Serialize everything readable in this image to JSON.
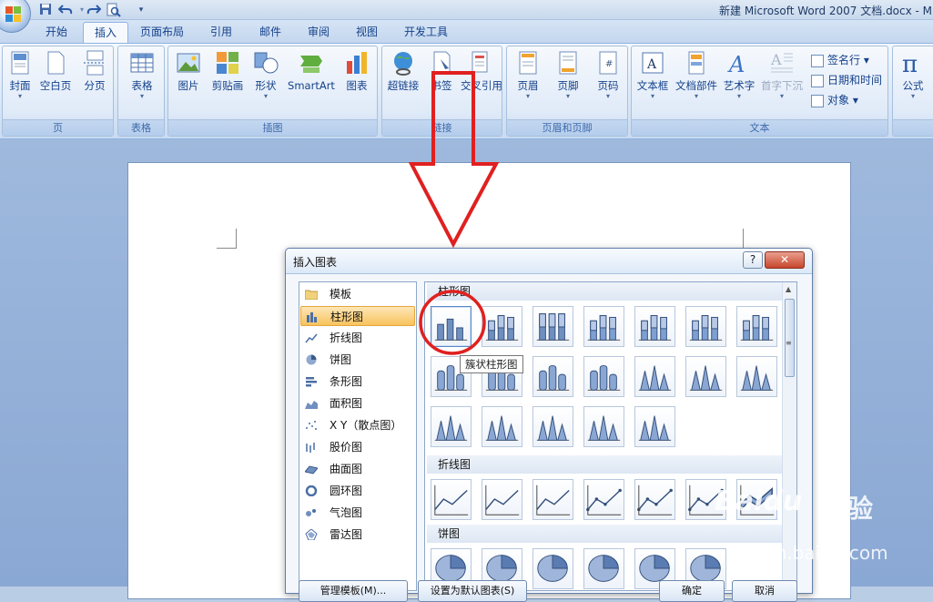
{
  "window": {
    "title": "新建 Microsoft Word 2007 文档.docx - M"
  },
  "quick_access": {
    "icons": [
      "save-icon",
      "undo-icon",
      "redo-icon",
      "print-preview-icon",
      "customize-icon"
    ]
  },
  "tabs": [
    {
      "label": "开始"
    },
    {
      "label": "插入",
      "active": true
    },
    {
      "label": "页面布局"
    },
    {
      "label": "引用"
    },
    {
      "label": "邮件"
    },
    {
      "label": "审阅"
    },
    {
      "label": "视图"
    },
    {
      "label": "开发工具"
    }
  ],
  "ribbon": {
    "groups": [
      {
        "label": "页",
        "buttons": [
          "封面",
          "空白页",
          "分页"
        ]
      },
      {
        "label": "表格",
        "buttons": [
          "表格"
        ]
      },
      {
        "label": "插图",
        "buttons": [
          "图片",
          "剪贴画",
          "形状",
          "SmartArt",
          "图表"
        ]
      },
      {
        "label": "链接",
        "buttons": [
          "超链接",
          "书签",
          "交叉引用"
        ]
      },
      {
        "label": "页眉和页脚",
        "buttons": [
          "页眉",
          "页脚",
          "页码"
        ]
      },
      {
        "label": "文本",
        "buttons": [
          "文本框",
          "文档部件",
          "艺术字",
          "首字下沉"
        ],
        "small": [
          "签名行",
          "日期和时间",
          "对象"
        ]
      },
      {
        "label": "",
        "buttons": [
          "公式"
        ]
      }
    ]
  },
  "dialog": {
    "title": "插入图表",
    "help": "?",
    "close": "✕",
    "categories": [
      "模板",
      "柱形图",
      "折线图",
      "饼图",
      "条形图",
      "面积图",
      "X Y（散点图）",
      "股价图",
      "曲面图",
      "圆环图",
      "气泡图",
      "雷达图"
    ],
    "selected_category": "柱形图",
    "sections": [
      "柱形图",
      "折线图",
      "饼图"
    ],
    "tooltip": "簇状柱形图",
    "buttons": [
      "管理模板(M)...",
      "设置为默认图表(S)",
      "确定",
      "取消"
    ]
  },
  "watermark": {
    "brand": "Baidu",
    "brand_cn": "经验",
    "url": "jingyan.baidu.com"
  },
  "colors": {
    "annotation_red": "#e02020",
    "selection_orange": "#f8c35e",
    "ribbon_blue": "#15428b"
  }
}
